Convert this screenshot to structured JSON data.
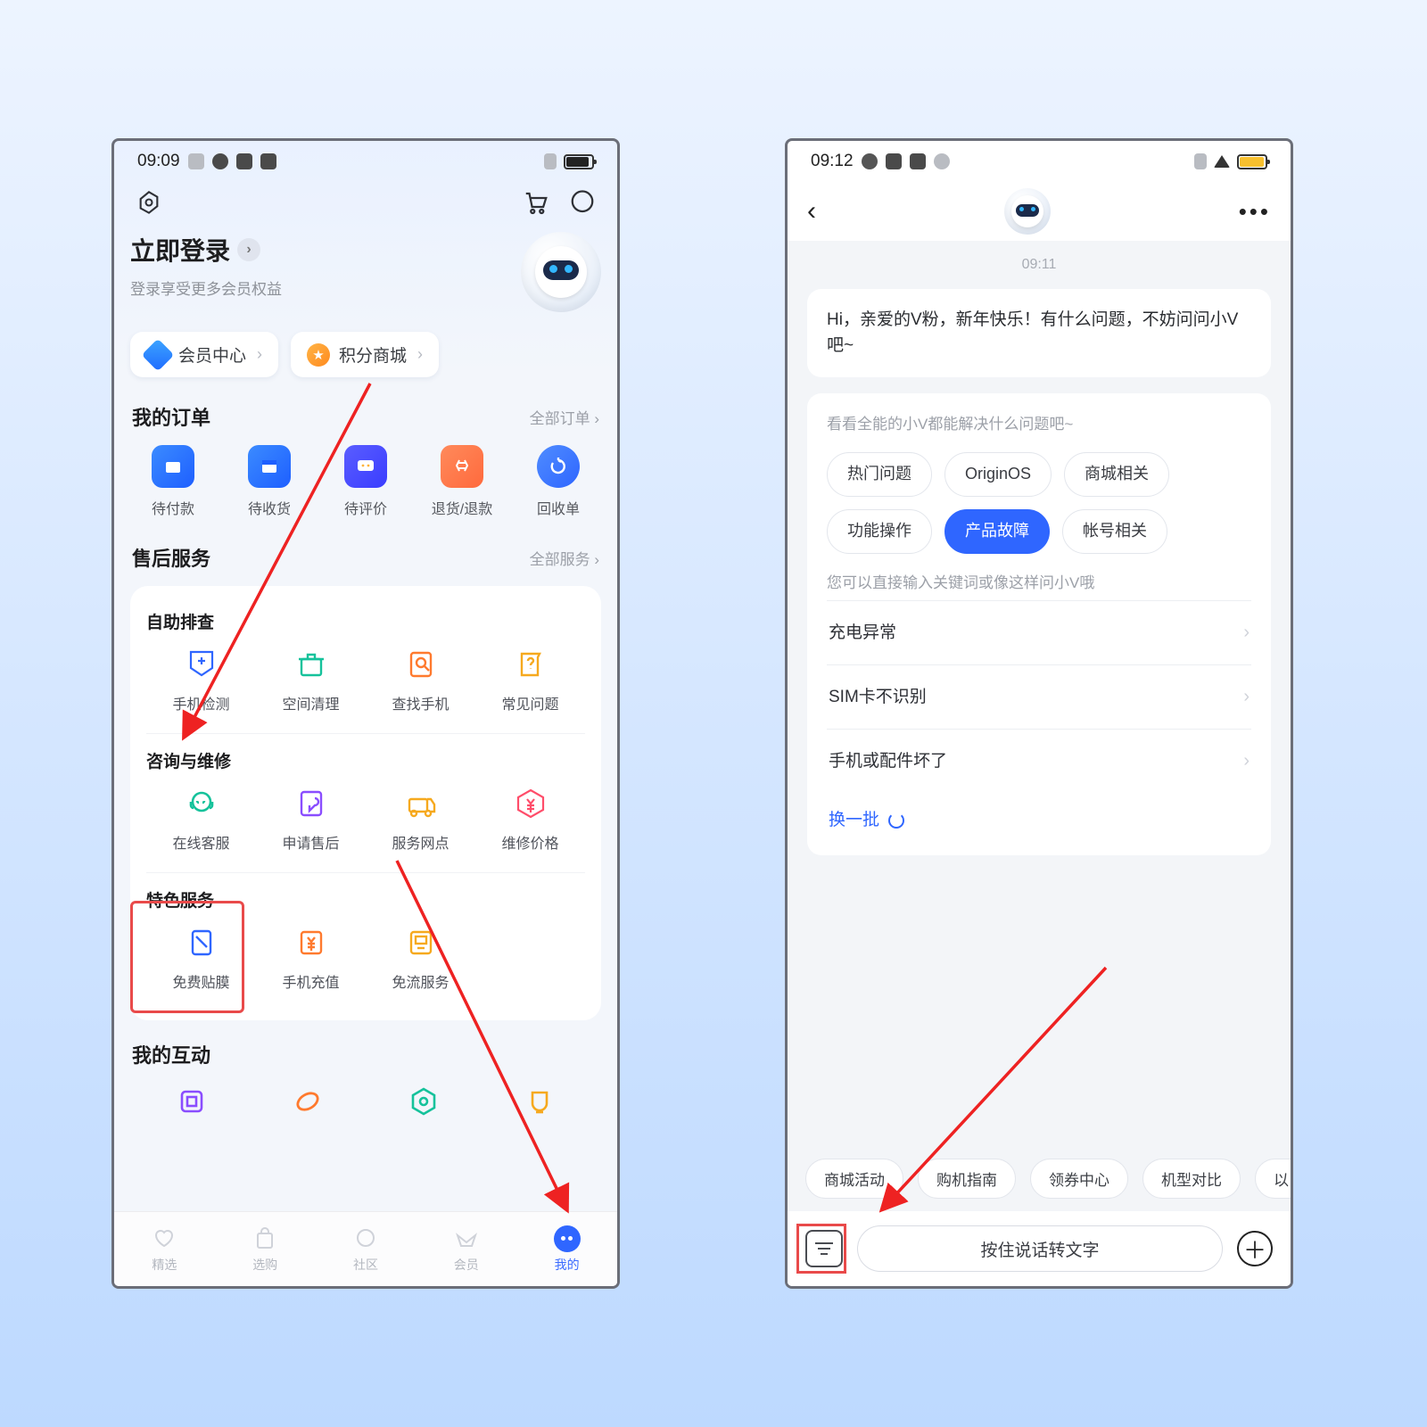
{
  "left": {
    "status": {
      "time": "09:09"
    },
    "login": {
      "title": "立即登录",
      "subtitle": "登录享受更多会员权益"
    },
    "pills": {
      "member": "会员中心",
      "points": "积分商城"
    },
    "orders": {
      "title": "我的订单",
      "more": "全部订单",
      "items": [
        "待付款",
        "待收货",
        "待评价",
        "退货/退款",
        "回收单"
      ]
    },
    "service": {
      "title": "售后服务",
      "more": "全部服务",
      "g1_title": "自助排查",
      "g1": [
        "手机检测",
        "空间清理",
        "查找手机",
        "常见问题"
      ],
      "g2_title": "咨询与维修",
      "g2": [
        "在线客服",
        "申请售后",
        "服务网点",
        "维修价格"
      ],
      "g3_title": "特色服务",
      "g3": [
        "免费贴膜",
        "手机充值",
        "免流服务"
      ]
    },
    "interaction": {
      "title": "我的互动"
    },
    "tabs": [
      "精选",
      "选购",
      "社区",
      "会员",
      "我的"
    ]
  },
  "right": {
    "status": {
      "time": "09:12"
    },
    "chat_time": "09:11",
    "greeting": "Hi，亲爱的V粉，新年快乐！有什么问题，不妨问问小V吧~",
    "card": {
      "hint": "看看全能的小V都能解决什么问题吧~",
      "chips": [
        "热门问题",
        "OriginOS",
        "商城相关",
        "功能操作",
        "产品故障",
        "帐号相关"
      ],
      "active_chip": "产品故障",
      "sub_hint": "您可以直接输入关键词或像这样问小V哦",
      "list": [
        "充电异常",
        "SIM卡不识别",
        "手机或配件坏了"
      ],
      "refresh": "换一批"
    },
    "suggestions": [
      "商城活动",
      "购机指南",
      "领券中心",
      "机型对比",
      "以"
    ],
    "input_placeholder": "按住说话转文字"
  }
}
